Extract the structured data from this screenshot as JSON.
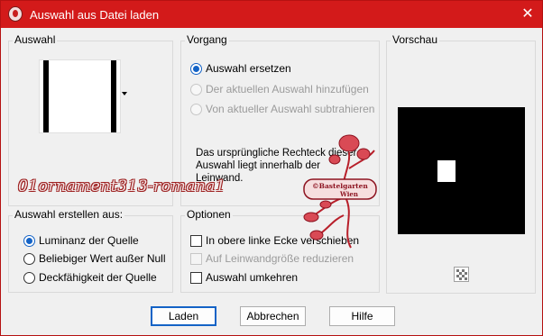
{
  "window": {
    "title": "Auswahl aus Datei laden",
    "close_glyph": "✕"
  },
  "auswahl_group": {
    "title": "Auswahl"
  },
  "vorgang_group": {
    "title": "Vorgang",
    "options": [
      {
        "label": "Auswahl ersetzen",
        "checked": true,
        "disabled": false
      },
      {
        "label": "Der aktuellen Auswahl hinzufügen",
        "checked": false,
        "disabled": true
      },
      {
        "label": "Von aktueller Auswahl subtrahieren",
        "checked": false,
        "disabled": true
      }
    ],
    "description": "Das ursprüngliche Rechteck dieser Auswahl liegt innerhalb der Leinwand."
  },
  "erstellen_group": {
    "title": "Auswahl erstellen aus:",
    "options": [
      {
        "label": "Luminanz der Quelle",
        "checked": true
      },
      {
        "label": "Beliebiger Wert außer Null",
        "checked": false
      },
      {
        "label": "Deckfähigkeit der Quelle",
        "checked": false
      }
    ]
  },
  "optionen_group": {
    "title": "Optionen",
    "checks": [
      {
        "label": "In obere linke Ecke verschieben",
        "checked": false,
        "disabled": false
      },
      {
        "label": "Auf Leinwandgröße reduzieren",
        "checked": false,
        "disabled": true
      },
      {
        "label": "Auswahl umkehren",
        "checked": false,
        "disabled": false
      }
    ]
  },
  "vorschau_group": {
    "title": "Vorschau"
  },
  "overlay": {
    "selection_name": "01ornament313-romana1",
    "stamp_line1": "©Bastelgarten",
    "stamp_line2": "Wien"
  },
  "buttons": {
    "load": "Laden",
    "cancel": "Abbrechen",
    "help": "Hilfe"
  },
  "colors": {
    "accent": "#1463c6",
    "titlebar": "#d31a1a"
  }
}
